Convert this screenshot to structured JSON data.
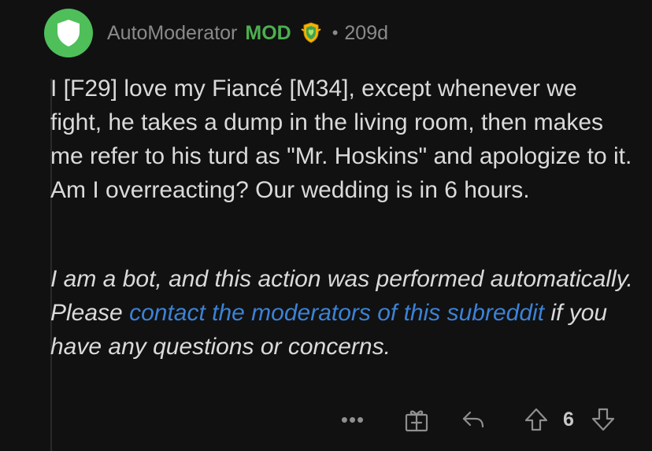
{
  "comment": {
    "username": "AutoModerator",
    "mod_label": "MOD",
    "separator": "•",
    "age": "209d",
    "body": "I [F29] love my Fiancé [M34], except whenever we fight, he takes a dump in the living room, then makes me refer to his turd as \"Mr. Hoskins\" and apologize to it. Am I overreacting? Our wedding is in 6 hours.",
    "bot_note": {
      "prefix": "I am a bot, and this action was performed automatically. Please ",
      "link_text": "contact the moderators of this subreddit",
      "suffix": " if you have any questions or concerns."
    }
  },
  "actions": {
    "more_label": "•••",
    "score": "6"
  },
  "colors": {
    "background": "#111111",
    "mod_green": "#4caf50",
    "avatar_green": "#4fbf5a",
    "link_blue": "#3b82d6",
    "muted_text": "#8a8a8a"
  },
  "icons": [
    "shield-avatar-icon",
    "mod-shield-badge-icon",
    "award-icon",
    "reply-icon",
    "upvote-icon",
    "downvote-icon"
  ]
}
